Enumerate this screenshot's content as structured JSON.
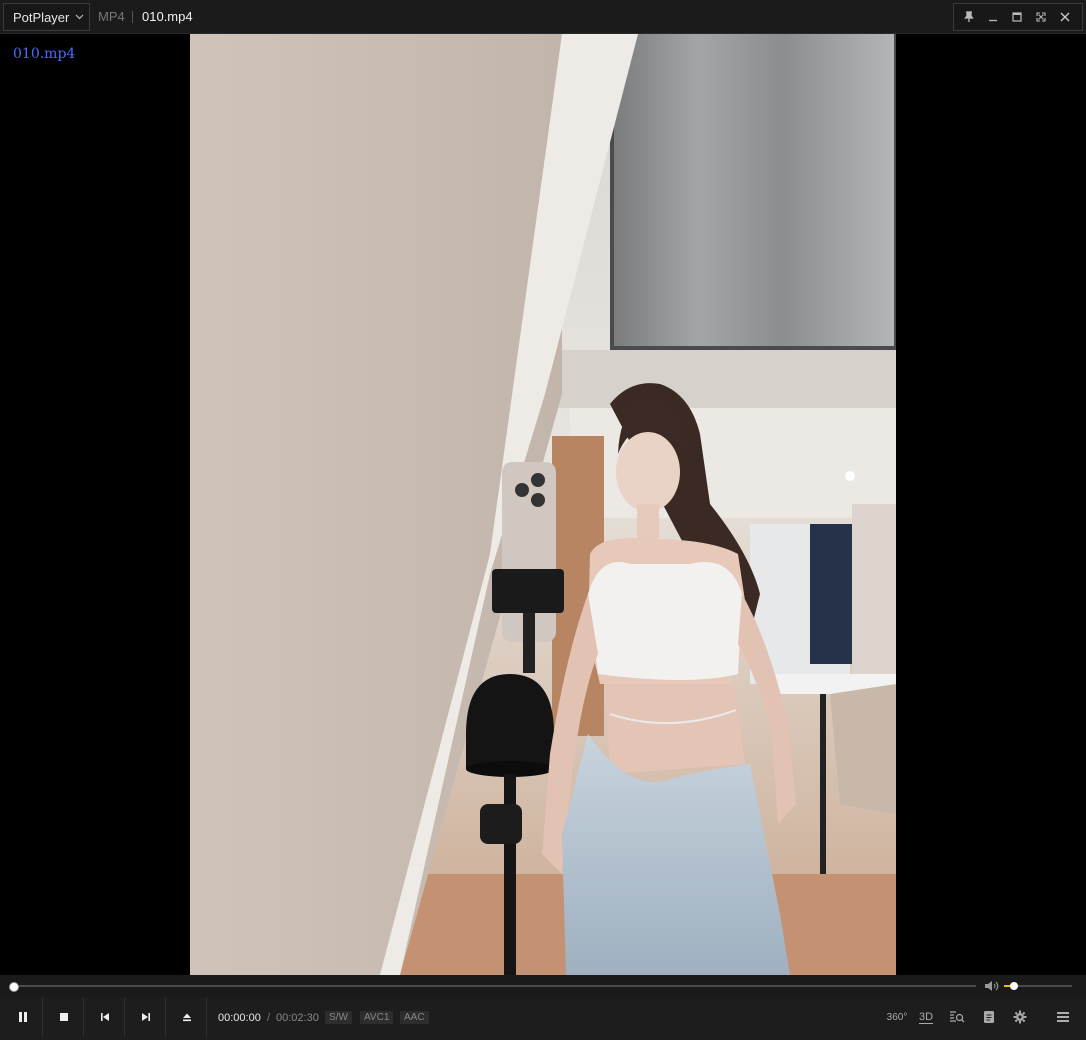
{
  "window": {
    "app_name": "PotPlayer",
    "format": "MP4",
    "file_title": "010.mp4"
  },
  "osd": {
    "filename": "010.mp4"
  },
  "playback": {
    "current_time": "00:00:00",
    "separator": "/",
    "duration": "00:02:30",
    "position_fraction": 0.0,
    "volume_fraction": 0.15
  },
  "badges": {
    "decoder": "S/W",
    "video_codec": "AVC1",
    "audio_codec": "AAC"
  },
  "right_buttons": {
    "vr": "360°",
    "stereo": "3D"
  },
  "colors": {
    "osd_text": "#4b6bff",
    "volume_accent": "#e8c100",
    "background": "#000000"
  }
}
